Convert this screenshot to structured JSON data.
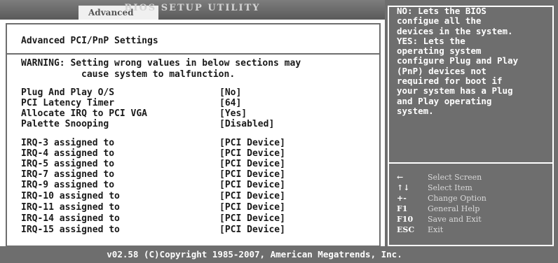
{
  "header": {
    "active_tab": "Advanced",
    "title": "BIOS SETUP UTILITY"
  },
  "main": {
    "heading": "Advanced PCI/PnP Settings",
    "warning_line1": "WARNING: Setting wrong values in below sections may",
    "warning_line2": "cause system to malfunction.",
    "settings": [
      {
        "label": "Plug And Play O/S",
        "value": "[No]"
      },
      {
        "label": "PCI Latency Timer",
        "value": "[64]"
      },
      {
        "label": "Allocate IRQ to PCI VGA",
        "value": "[Yes]"
      },
      {
        "label": "Palette Snooping",
        "value": "[Disabled]"
      }
    ],
    "irq_settings": [
      {
        "label": "IRQ-3 assigned to",
        "value": "[PCI Device]"
      },
      {
        "label": "IRQ-4 assigned to",
        "value": "[PCI Device]"
      },
      {
        "label": "IRQ-5 assigned to",
        "value": "[PCI Device]"
      },
      {
        "label": "IRQ-7 assigned to",
        "value": "[PCI Device]"
      },
      {
        "label": "IRQ-9 assigned to",
        "value": "[PCI Device]"
      },
      {
        "label": "IRQ-10 assigned to",
        "value": "[PCI Device]"
      },
      {
        "label": "IRQ-11 assigned to",
        "value": "[PCI Device]"
      },
      {
        "label": "IRQ-14 assigned to",
        "value": "[PCI Device]"
      },
      {
        "label": "IRQ-15 assigned to",
        "value": "[PCI Device]"
      }
    ]
  },
  "help": {
    "text": "NO: Lets the BIOS\nconfigue all the\ndevices in the system.\nYES: Lets the\noperating system\nconfigure Plug and Play\n(PnP) devices not\nrequired for boot if\nyour system has a Plug\nand Play operating\nsystem.",
    "keys": [
      {
        "key": "←",
        "desc": "Select Screen"
      },
      {
        "key": "↑↓",
        "desc": "Select Item"
      },
      {
        "key": "+-",
        "desc": "Change Option"
      },
      {
        "key": "F1",
        "desc": "General Help"
      },
      {
        "key": "F10",
        "desc": "Save and Exit"
      },
      {
        "key": "ESC",
        "desc": "Exit"
      }
    ]
  },
  "footer": {
    "copyright": "v02.58 (C)Copyright 1985-2007, American Megatrends, Inc."
  },
  "colors": {
    "frame_gray": "#6e6e6e",
    "background": "#ffffff",
    "text": "#1a1a1a"
  }
}
